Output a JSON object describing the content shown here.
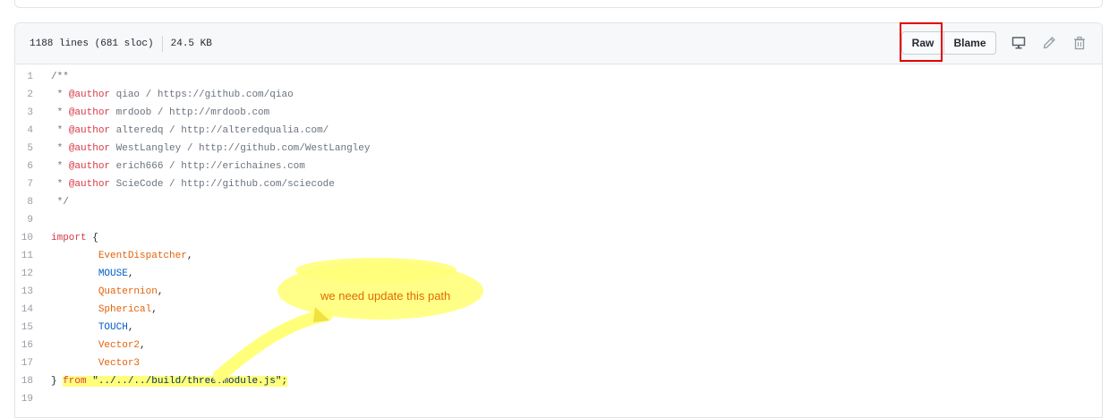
{
  "file_header": {
    "lines_info": "1188 lines (681 sloc)",
    "size": "24.5 KB",
    "raw_label": "Raw",
    "blame_label": "Blame"
  },
  "code_lines": [
    {
      "n": "1"
    },
    {
      "n": "2"
    },
    {
      "n": "3"
    },
    {
      "n": "4"
    },
    {
      "n": "5"
    },
    {
      "n": "6"
    },
    {
      "n": "7"
    },
    {
      "n": "8"
    },
    {
      "n": "9"
    },
    {
      "n": "10"
    },
    {
      "n": "11"
    },
    {
      "n": "12"
    },
    {
      "n": "13"
    },
    {
      "n": "14"
    },
    {
      "n": "15"
    },
    {
      "n": "16"
    },
    {
      "n": "17"
    },
    {
      "n": "18"
    },
    {
      "n": "19"
    }
  ],
  "code": {
    "l1": "/**",
    "author_tag": "@author",
    "l2_pre": " * ",
    "l2_rest": " qiao / https://github.com/qiao",
    "l3_rest": " mrdoob / http://mrdoob.com",
    "l4_rest": " alteredq / http://alteredqualia.com/",
    "l5_rest": " WestLangley / http://github.com/WestLangley",
    "l6_rest": " erich666 / http://erichaines.com",
    "l7_rest": " ScieCode / http://github.com/sciecode",
    "l8": " */",
    "import_kw": "import",
    "import_brace": " {",
    "names": [
      "EventDispatcher",
      "MOUSE",
      "Quaternion",
      "Spherical",
      "TOUCH",
      "Vector2",
      "Vector3"
    ],
    "commas": [
      ",",
      ",",
      ",",
      ",",
      ",",
      ",",
      ""
    ],
    "close_brace": "} ",
    "from_kw": "from",
    "path_str": "\"../../../build/three.module.js\"",
    "semicolon": ";"
  },
  "annotation": {
    "text": "we need update this path",
    "color": "#e06b00",
    "highlight_color": "#ffff7a"
  },
  "icons": {
    "display": "desktop-icon",
    "edit": "pencil-icon",
    "delete": "trash-icon"
  }
}
